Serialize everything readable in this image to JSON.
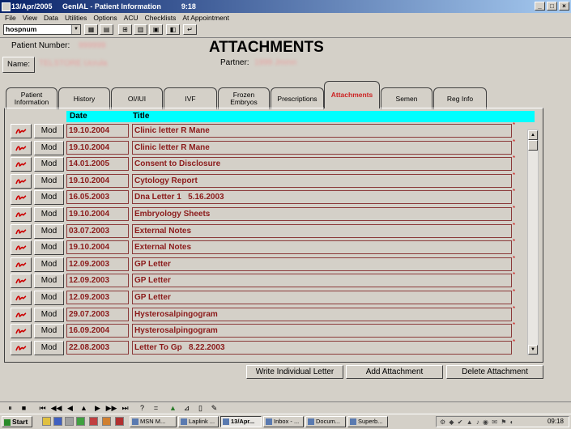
{
  "window": {
    "title": "13/Apr/2005     GenIAL - Patient Information          9:18",
    "buttons": [
      "_",
      "□",
      "×"
    ]
  },
  "menu": [
    "File",
    "View",
    "Data",
    "Utilities",
    "Options",
    "ACU",
    "Checklists",
    "At Appointment"
  ],
  "toolbar": {
    "combo_value": "hospnum",
    "icons": [
      "grid-icon",
      "table-icon",
      "tree-icon",
      "columns-icon",
      "note-icon",
      "export-icon",
      "return-icon"
    ]
  },
  "patient": {
    "number_label": "Patient Number:",
    "number_value": "999999",
    "name_button": "Name:",
    "name_value": "TELSTORE Ucrula",
    "partner_label": "Partner:",
    "partner_value": "1999 Jmmn"
  },
  "page_title": "ATTACHMENTS",
  "tabs": [
    {
      "label": "Patient Information"
    },
    {
      "label": "History"
    },
    {
      "label": "OI/IUI"
    },
    {
      "label": "IVF"
    },
    {
      "label": "Frozen Embryos"
    },
    {
      "label": "Prescriptions"
    },
    {
      "label": "Attachments"
    },
    {
      "label": "Semen"
    },
    {
      "label": "Reg Info"
    }
  ],
  "active_tab": "Attachments",
  "table": {
    "headers": {
      "date": "Date",
      "title": "Title"
    },
    "mod_label": "Mod",
    "rows": [
      {
        "date": "19.10.2004",
        "title": "Clinic letter R Mane"
      },
      {
        "date": "19.10.2004",
        "title": "Clinic letter R Mane"
      },
      {
        "date": "14.01.2005",
        "title": "Consent to Disclosure"
      },
      {
        "date": "19.10.2004",
        "title": "Cytology Report"
      },
      {
        "date": "16.05.2003",
        "title": "Dna Letter 1   5.16.2003"
      },
      {
        "date": "19.10.2004",
        "title": "Embryology Sheets"
      },
      {
        "date": "03.07.2003",
        "title": "External Notes"
      },
      {
        "date": "19.10.2004",
        "title": "External Notes"
      },
      {
        "date": "12.09.2003",
        "title": "GP Letter"
      },
      {
        "date": "12.09.2003",
        "title": "GP Letter"
      },
      {
        "date": "12.09.2003",
        "title": "GP Letter"
      },
      {
        "date": "29.07.2003",
        "title": "Hysterosalpingogram"
      },
      {
        "date": "16.09.2004",
        "title": "Hysterosalpingogram"
      },
      {
        "date": "22.08.2003",
        "title": "Letter To Gp   8.22.2003"
      }
    ]
  },
  "actions": {
    "write_letter": "Write Individual Letter",
    "add": "Add Attachment",
    "delete": "Delete Attachment"
  },
  "nav": [
    "⏸",
    "■",
    "⏮",
    "◀◀",
    "◀",
    "▲",
    "▶",
    "▶▶",
    "⏭",
    "?",
    "=",
    "",
    "",
    "",
    ""
  ],
  "taskbar": {
    "start": "Start",
    "tasks": [
      {
        "label": "MSN M..."
      },
      {
        "label": "Laplink ..."
      },
      {
        "label": "13/Apr..."
      },
      {
        "label": "Inbox - ..."
      },
      {
        "label": "Docum..."
      },
      {
        "label": "Superb..."
      }
    ],
    "active_task": "13/Apr...",
    "clock": "09:18"
  }
}
